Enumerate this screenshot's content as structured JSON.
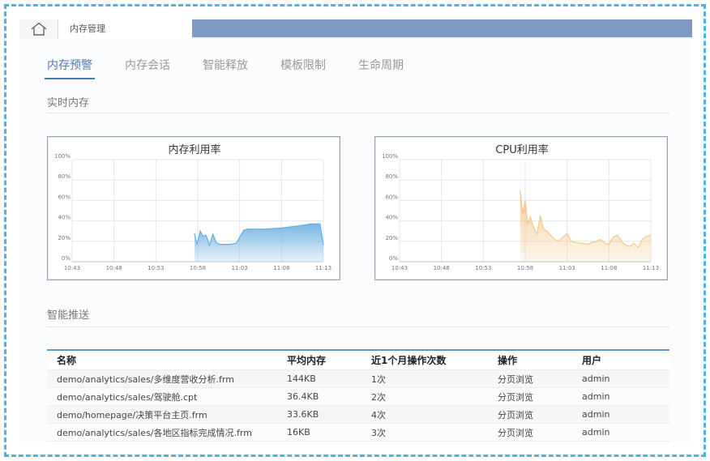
{
  "header": {
    "tab_title": "内存管理",
    "home_icon": "home-icon"
  },
  "nav": {
    "tabs": [
      {
        "label": "内存预警",
        "active": true
      },
      {
        "label": "内存会话",
        "active": false
      },
      {
        "label": "智能释放",
        "active": false
      },
      {
        "label": "模板限制",
        "active": false
      },
      {
        "label": "生命周期",
        "active": false
      }
    ]
  },
  "sections": {
    "realtime": "实时内存",
    "push": "智能推送"
  },
  "charts": {
    "time_ticks": [
      "10:43",
      "10:48",
      "10:53",
      "10:58",
      "11:03",
      "11:08",
      "11:13"
    ],
    "percent_ticks": [
      "100%",
      "80%",
      "60%",
      "40%",
      "20%",
      "0%"
    ]
  },
  "chart_data": [
    {
      "type": "area",
      "title": "内存利用率",
      "xlabel": "",
      "ylabel": "",
      "ylim": [
        0,
        100
      ],
      "x_range_minutes": [
        0,
        30
      ],
      "grid": true,
      "color": "#6aaee0",
      "series": [
        {
          "x": [
            14.6,
            14.9,
            15.3,
            15.6,
            16.0,
            16.4,
            16.8,
            17.2,
            17.6,
            18.0,
            18.8,
            19.6,
            20.5,
            21.0,
            21.5,
            23.0,
            25.0,
            27.0,
            28.5,
            29.0,
            29.6,
            30.0
          ],
          "y": [
            28,
            17,
            30,
            25,
            26,
            16,
            27,
            19,
            17,
            17,
            17,
            18,
            31,
            32,
            32,
            32,
            33,
            35,
            37,
            37,
            37,
            16
          ]
        }
      ]
    },
    {
      "type": "area",
      "title": "CPU利用率",
      "xlabel": "",
      "ylabel": "",
      "ylim": [
        0,
        100
      ],
      "x_range_minutes": [
        0,
        30
      ],
      "grid": true,
      "color": "#f2c98a",
      "series": [
        {
          "x": [
            14.4,
            14.7,
            15.0,
            15.3,
            15.6,
            16.0,
            16.4,
            16.8,
            17.2,
            17.6,
            18.0,
            18.5,
            19.0,
            19.5,
            20.0,
            20.5,
            21.0,
            21.5,
            22.0,
            22.5,
            23.0,
            23.5,
            24.0,
            24.5,
            25.0,
            25.5,
            26.0,
            26.5,
            27.0,
            27.5,
            28.0,
            28.5,
            29.0,
            29.5,
            30.0
          ],
          "y": [
            70,
            47,
            60,
            37,
            44,
            34,
            27,
            45,
            32,
            30,
            26,
            22,
            20,
            24,
            28,
            20,
            19,
            18,
            18,
            17,
            19,
            20,
            22,
            18,
            17,
            24,
            26,
            20,
            16,
            15,
            18,
            14,
            22,
            25,
            26
          ]
        }
      ]
    }
  ],
  "table": {
    "headers": [
      "名称",
      "平均内存",
      "近1个月操作次数",
      "操作",
      "用户"
    ],
    "rows": [
      [
        "demo/analytics/sales/多维度营收分析.frm",
        "144KB",
        "1次",
        "分页浏览",
        "admin"
      ],
      [
        "demo/analytics/sales/驾驶舱.cpt",
        "36.4KB",
        "2次",
        "分页浏览",
        "admin"
      ],
      [
        "demo/homepage/决策平台主页.frm",
        "33.6KB",
        "4次",
        "分页浏览",
        "admin"
      ],
      [
        "demo/analytics/sales/各地区指标完成情况.frm",
        "16KB",
        "3次",
        "分页浏览",
        "admin"
      ]
    ]
  }
}
